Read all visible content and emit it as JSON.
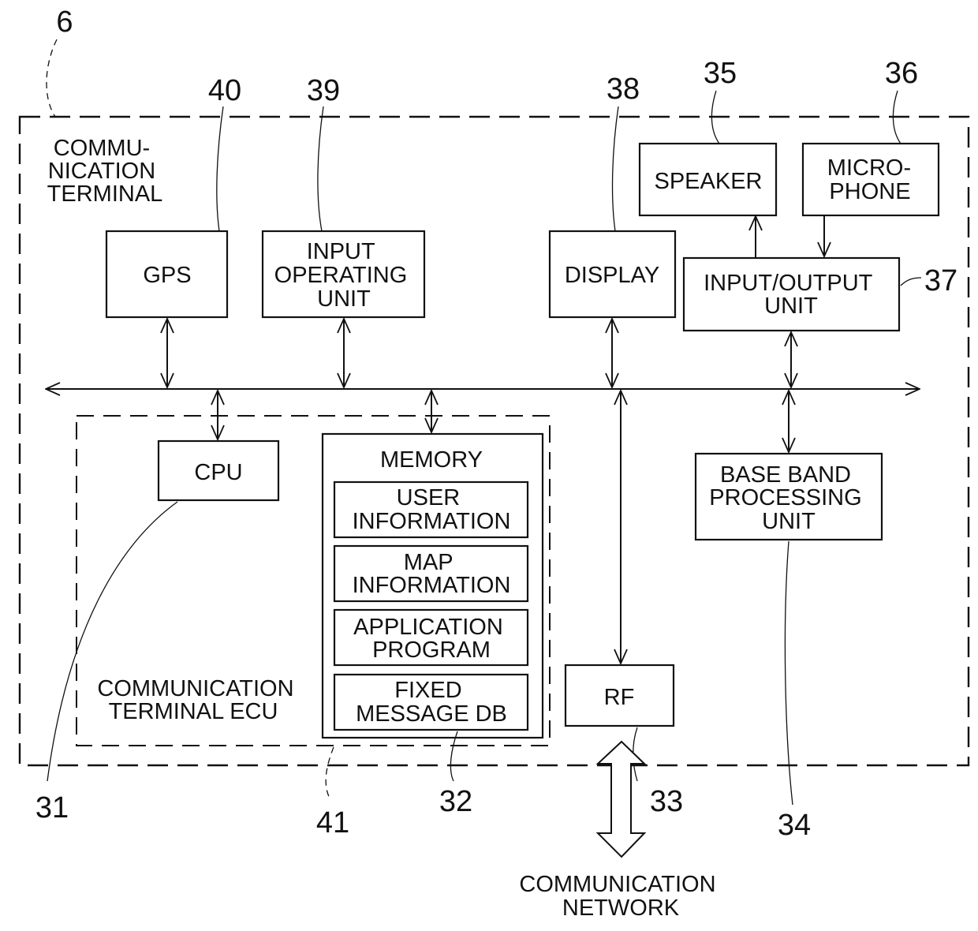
{
  "diagram": {
    "outer_block": {
      "ref": "6",
      "title_lines": [
        "COMMU-",
        "NICATION",
        "TERMINAL"
      ]
    },
    "ecu_block": {
      "ref": "41",
      "title_lines": [
        "COMMUNICATION",
        "TERMINAL ECU"
      ]
    },
    "components": {
      "gps": {
        "ref": "40",
        "lines": [
          "GPS"
        ]
      },
      "input_operating_unit": {
        "ref": "39",
        "lines": [
          "INPUT",
          "OPERATING",
          "UNIT"
        ]
      },
      "display": {
        "ref": "38",
        "lines": [
          "DISPLAY"
        ]
      },
      "speaker": {
        "ref": "35",
        "lines": [
          "SPEAKER"
        ]
      },
      "microphone": {
        "ref": "36",
        "lines": [
          "MICRO-",
          "PHONE"
        ]
      },
      "input_output_unit": {
        "ref": "37",
        "lines": [
          "INPUT/OUTPUT",
          "UNIT"
        ]
      },
      "cpu": {
        "ref": "31",
        "lines": [
          "CPU"
        ]
      },
      "memory": {
        "ref": "32",
        "title": "MEMORY",
        "sections": [
          {
            "lines": [
              "USER",
              "INFORMATION"
            ]
          },
          {
            "lines": [
              "MAP",
              "INFORMATION"
            ]
          },
          {
            "lines": [
              "APPLICATION",
              "PROGRAM"
            ]
          },
          {
            "lines": [
              "FIXED",
              "MESSAGE DB"
            ]
          }
        ]
      },
      "rf": {
        "ref": "33",
        "lines": [
          "RF"
        ]
      },
      "baseband": {
        "ref": "34",
        "lines": [
          "BASE BAND",
          "PROCESSING",
          "UNIT"
        ]
      }
    },
    "external": {
      "network_lines": [
        "COMMUNICATION",
        "NETWORK"
      ]
    }
  }
}
